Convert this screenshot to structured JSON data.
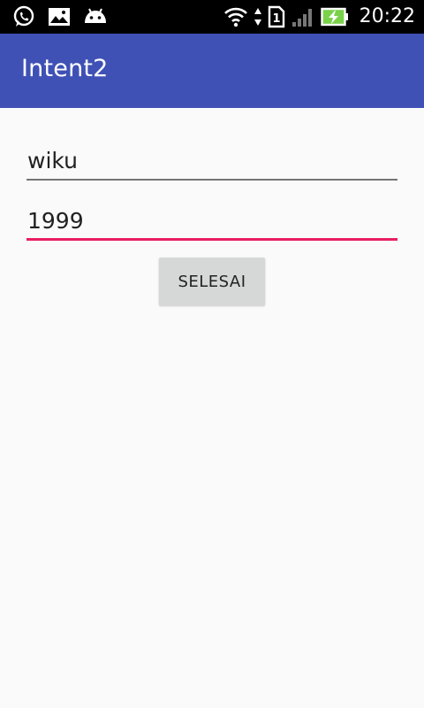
{
  "status_bar": {
    "time": "20:22",
    "sim_slot": "1",
    "left_icons": [
      "whatsapp-icon",
      "image-icon",
      "android-icon"
    ],
    "right_icons": [
      "wifi-icon",
      "data-arrows-icon",
      "sim-card-icon",
      "signal-icon",
      "battery-charging-icon"
    ]
  },
  "app_bar": {
    "title": "Intent2",
    "color": "#3f51b5"
  },
  "form": {
    "name_value": "wiku",
    "year_value": "1999",
    "focused_underline_color": "#e91e63",
    "submit_label": "SELESAI"
  }
}
